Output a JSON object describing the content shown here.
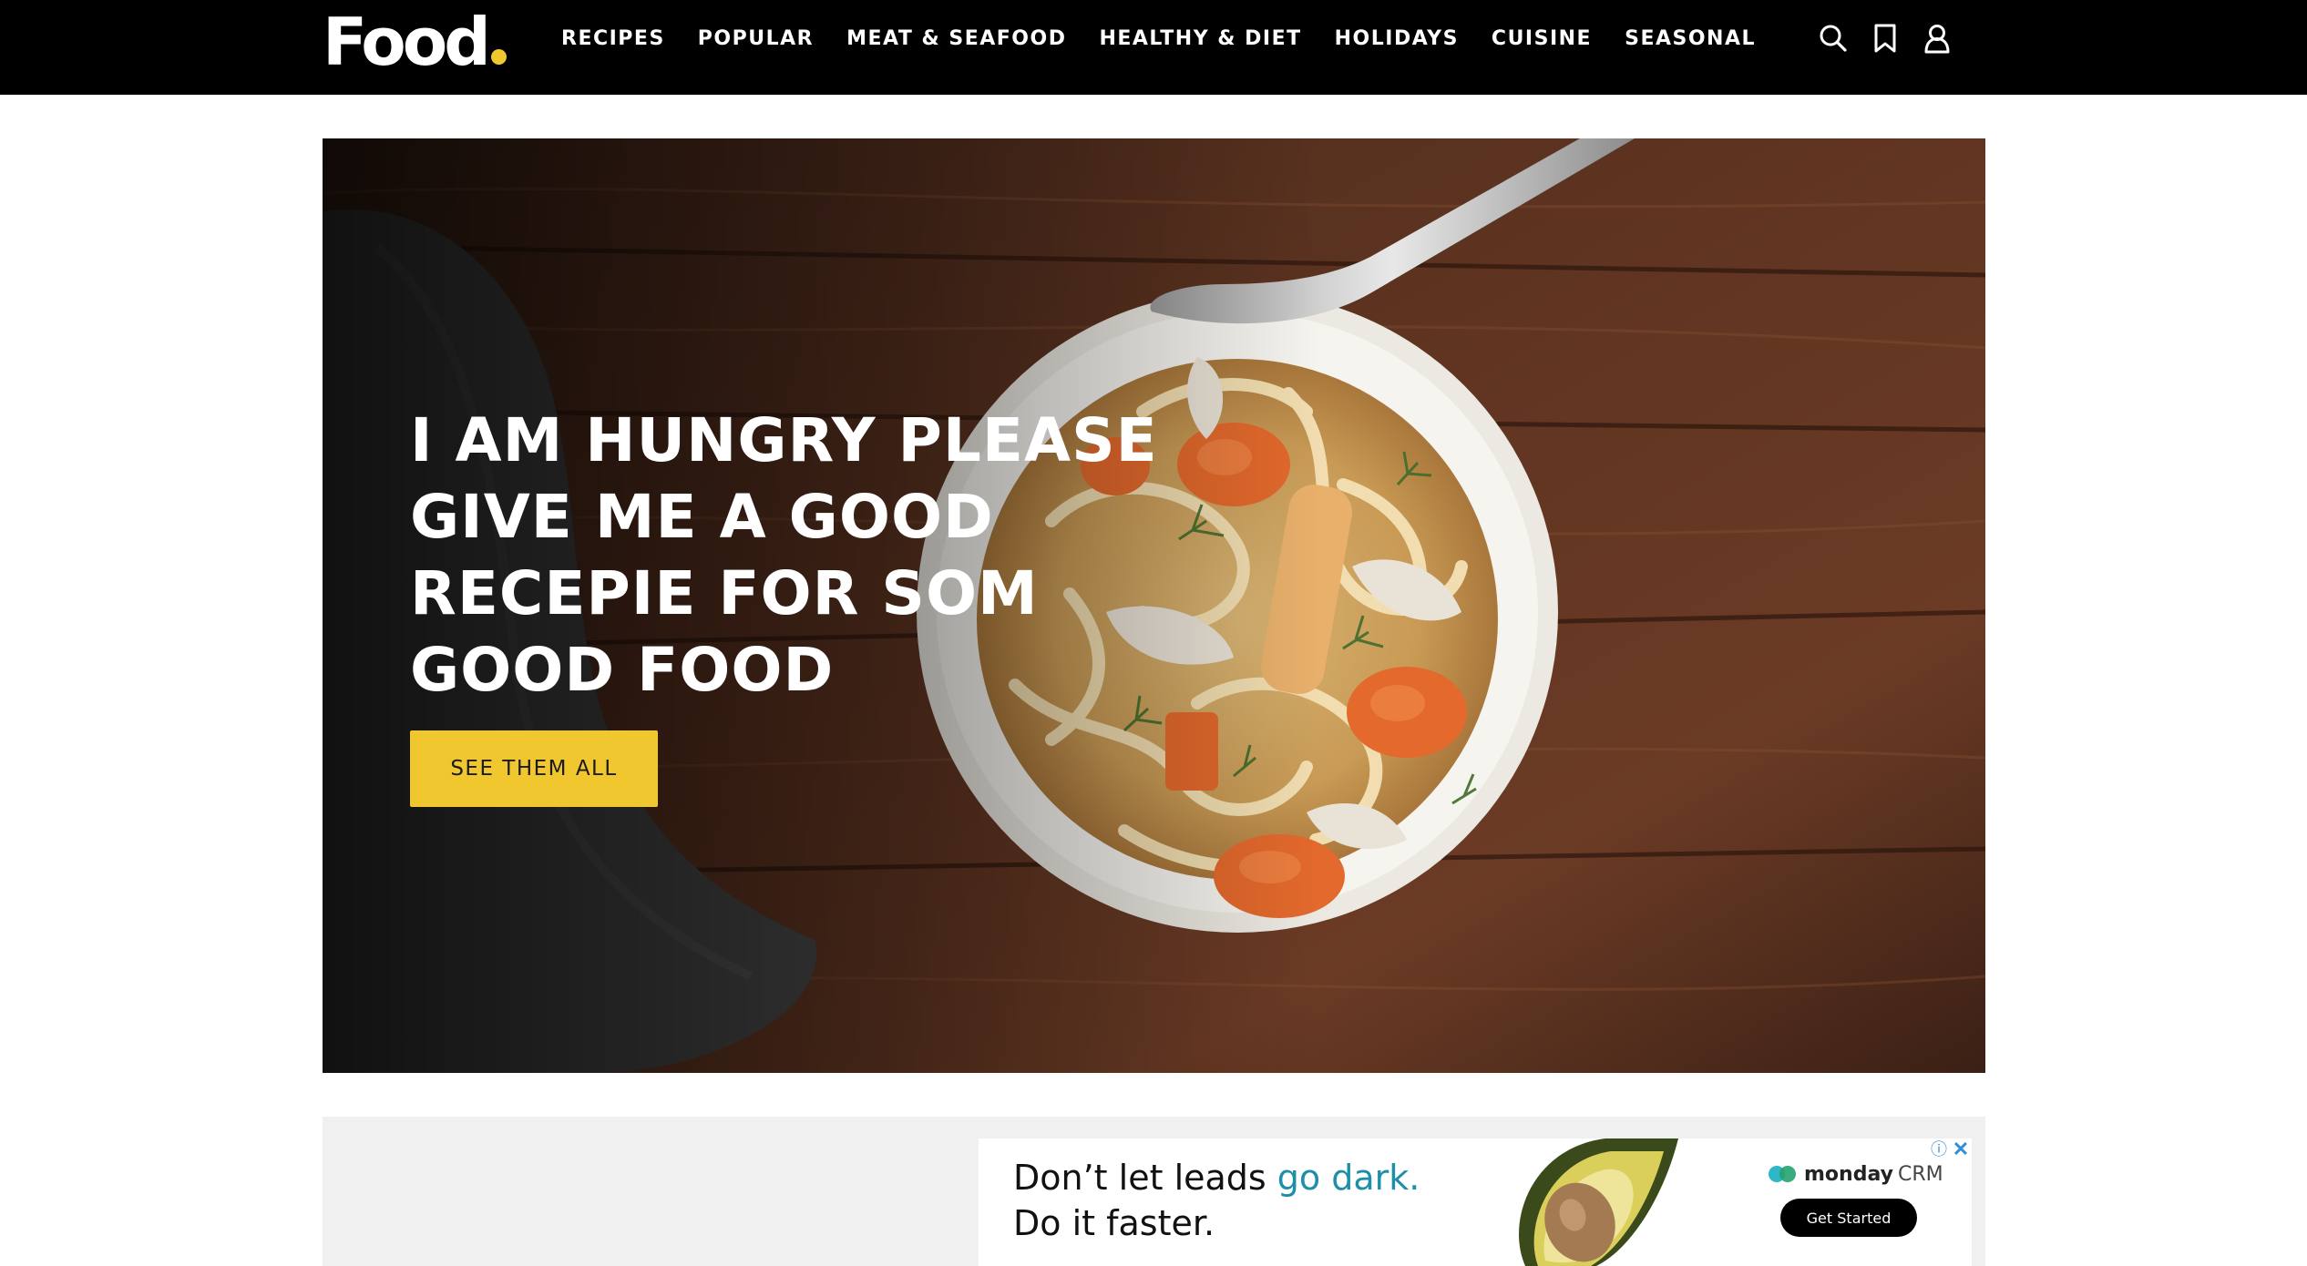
{
  "header": {
    "logo_text": "Food",
    "nav": [
      {
        "label": "RECIPES"
      },
      {
        "label": "POPULAR"
      },
      {
        "label": "MEAT & SEAFOOD"
      },
      {
        "label": "HEALTHY & DIET"
      },
      {
        "label": "HOLIDAYS"
      },
      {
        "label": "CUISINE"
      },
      {
        "label": "SEASONAL"
      }
    ],
    "icons": [
      "search-icon",
      "bookmark-icon",
      "user-icon"
    ]
  },
  "hero": {
    "title": "I AM HUNGRY PLEASE GIVE ME A GOOD RECEPIE FOR SOM GOOD FOOD",
    "cta_label": "SEE THEM ALL",
    "image_subject": "chicken-noodle-soup"
  },
  "ad": {
    "headline_line1_start": "Don’t let leads ",
    "headline_line1_accent": "go dark.",
    "headline_line2": "Do it faster.",
    "brand_name": "monday",
    "brand_suffix": "CRM",
    "cta_label": "Get Started",
    "info_glyph": "ⓘ",
    "close_glyph": "✕"
  },
  "colors": {
    "header_bg": "#000000",
    "brand_yellow": "#f1c72f",
    "ad_accent": "#1f8fa8",
    "ad_band_bg": "#f0f0f0"
  }
}
